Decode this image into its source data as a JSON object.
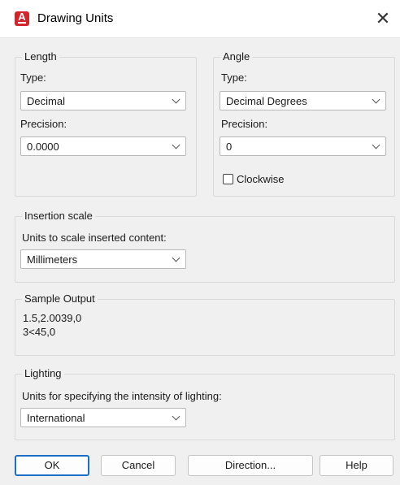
{
  "window": {
    "title": "Drawing Units",
    "close_glyph": "✕",
    "app_icon": "autocad-logo-icon"
  },
  "length": {
    "label": "Length",
    "type_label": "Type:",
    "type_value": "Decimal",
    "precision_label": "Precision:",
    "precision_value": "0.0000"
  },
  "angle": {
    "label": "Angle",
    "type_label": "Type:",
    "type_value": "Decimal Degrees",
    "precision_label": "Precision:",
    "precision_value": "0",
    "clockwise_label": "Clockwise",
    "clockwise_checked": false
  },
  "insertion_scale": {
    "label": "Insertion scale",
    "units_label": "Units to scale inserted content:",
    "units_value": "Millimeters"
  },
  "sample_output": {
    "label": "Sample Output",
    "line1": "1.5,2.0039,0",
    "line2": "3<45,0"
  },
  "lighting": {
    "label": "Lighting",
    "units_label": "Units for specifying the intensity of lighting:",
    "units_value": "International"
  },
  "buttons": {
    "ok": "OK",
    "cancel": "Cancel",
    "direction": "Direction...",
    "help": "Help"
  },
  "colors": {
    "background": "#f0f0f0",
    "accent": "#1c6fc7",
    "icon_red": "#d3262c"
  }
}
